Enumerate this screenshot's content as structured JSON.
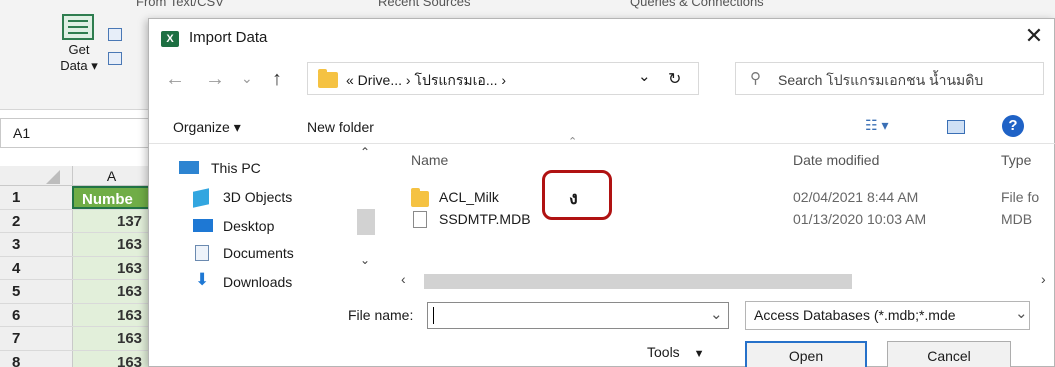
{
  "excel": {
    "ribbon_top": [
      "From Text/CSV",
      "Recent Sources",
      "Queries & Connections"
    ],
    "get_data_label": "Get",
    "get_data_label2": "Data ▾",
    "namebox": "A1",
    "column_header": "A",
    "rows": [
      {
        "num": "1",
        "value": "Numbe"
      },
      {
        "num": "2",
        "value": "137"
      },
      {
        "num": "3",
        "value": "163"
      },
      {
        "num": "4",
        "value": "163"
      },
      {
        "num": "5",
        "value": "163"
      },
      {
        "num": "6",
        "value": "163"
      },
      {
        "num": "7",
        "value": "163"
      },
      {
        "num": "8",
        "value": "163"
      }
    ]
  },
  "dialog": {
    "title": "Import Data",
    "title_icon": "X",
    "close": "✕",
    "address": {
      "path": "« Drive...  ›  โปรแกรมเอ...  ›",
      "dropdown": "⌄",
      "refresh": "↻"
    },
    "search_placeholder": "Search โปรแกรมเอกชน น้ำนมดิบ",
    "toolbar": {
      "organize": "Organize ▾",
      "new_folder": "New folder",
      "help": "?"
    },
    "nav": [
      {
        "label": "This PC",
        "icon": "pc-icon"
      },
      {
        "label": "3D Objects",
        "icon": "cube-icon"
      },
      {
        "label": "Desktop",
        "icon": "desktop-icon"
      },
      {
        "label": "Documents",
        "icon": "documents-icon"
      },
      {
        "label": "Downloads",
        "icon": "download-icon"
      }
    ],
    "columns": {
      "name": "Name",
      "date": "Date modified",
      "type": "Type"
    },
    "files": [
      {
        "name": "ACL_Milk",
        "date": "02/04/2021 8:44 AM",
        "type": "File fo",
        "icon": "folder-icon"
      },
      {
        "name": "SSDMTP.MDB",
        "date": "01/13/2020 10:03 AM",
        "type": "MDB",
        "icon": "file-icon"
      }
    ],
    "annotation_mark": "ง",
    "file_name_label": "File name:",
    "file_name_value": "",
    "file_type": "Access Databases (*.mdb;*.mde",
    "tools": "Tools",
    "open": "Open",
    "cancel": "Cancel"
  },
  "colors": {
    "excel_green": "#217346",
    "header_cell": "#70ad47",
    "data_cell": "#e2efda",
    "highlight": "#b01212",
    "help_blue": "#1f62c6",
    "folder": "#f5c242",
    "primary_border": "#2671c9"
  }
}
